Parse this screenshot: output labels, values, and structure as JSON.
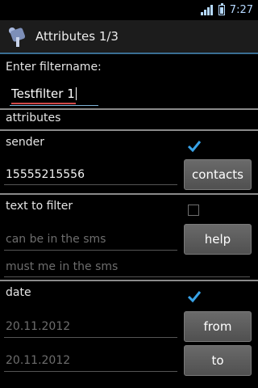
{
  "status_bar": {
    "time": "7:27"
  },
  "action_bar": {
    "title": "Attributes 1/3"
  },
  "filter": {
    "label": "Enter filtername:",
    "value": "Testfilter 1"
  },
  "attributes_header": "attributes",
  "sender": {
    "label": "sender",
    "checked": true,
    "value": "15555215556",
    "button": "contacts"
  },
  "text_to_filter": {
    "label": "text to filter",
    "checked": false,
    "can_be_placeholder": "can be in the sms",
    "must_be_placeholder": "must me in the sms",
    "button": "help"
  },
  "date": {
    "label": "date",
    "checked": true,
    "from_value": "20.11.2012",
    "to_value": "20.11.2012",
    "from_button": "from",
    "to_button": "to"
  },
  "colors": {
    "accent": "#3a6e93",
    "check": "#38a3e8",
    "spell_underline": "#d04848"
  }
}
